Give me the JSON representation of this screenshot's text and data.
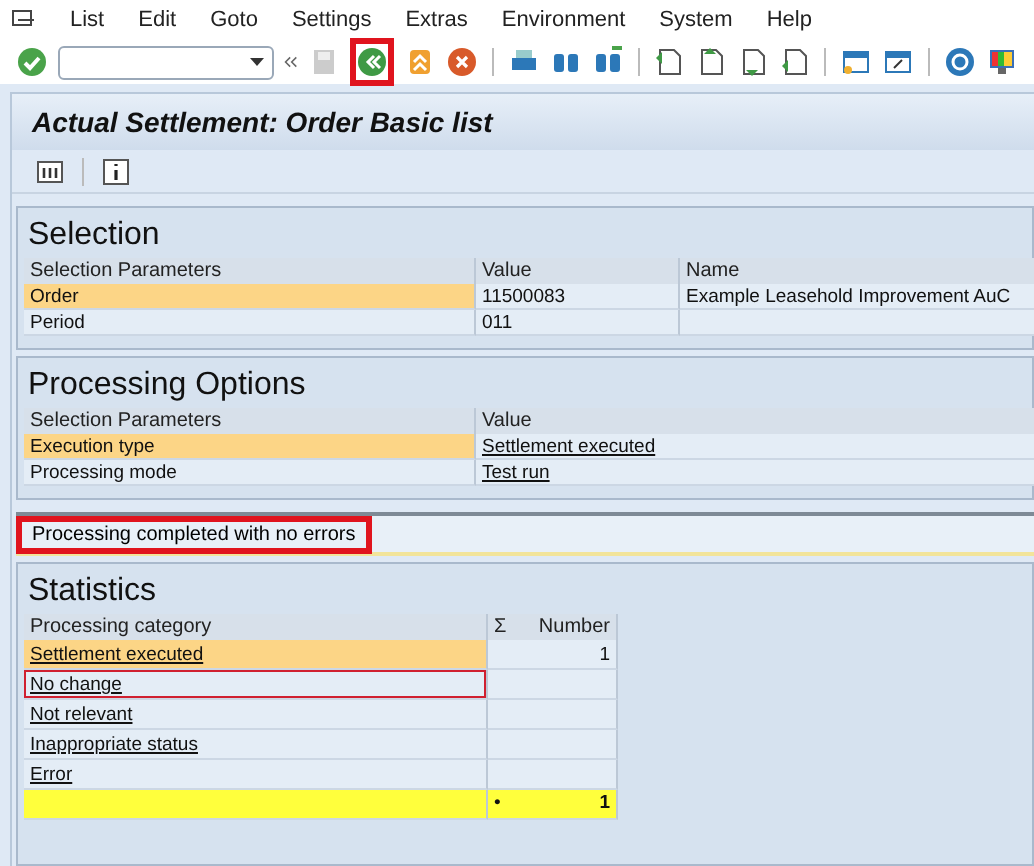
{
  "menu": [
    "List",
    "Edit",
    "Goto",
    "Settings",
    "Extras",
    "Environment",
    "System",
    "Help"
  ],
  "toolbar": {
    "back_framed": true
  },
  "title": "Actual Settlement: Order Basic list",
  "selection": {
    "heading": "Selection",
    "columns": [
      "Selection Parameters",
      "Value",
      "Name"
    ],
    "rows": [
      {
        "cells": [
          "Order",
          "11500083",
          "Example Leasehold Improvement AuC"
        ],
        "highlighted": true
      },
      {
        "cells": [
          "Period",
          "011",
          ""
        ],
        "highlighted": false
      }
    ]
  },
  "processing_options": {
    "heading": "Processing Options",
    "columns": [
      "Selection Parameters",
      "Value"
    ],
    "rows": [
      {
        "cells": [
          "Execution type",
          "Settlement executed"
        ],
        "highlighted": true
      },
      {
        "cells": [
          "Processing mode",
          "Test run"
        ],
        "highlighted": false
      }
    ]
  },
  "message": {
    "text": "Processing completed with no errors",
    "framed": true
  },
  "statistics": {
    "heading": "Statistics",
    "columns": [
      "Processing category",
      "Σ",
      "Number"
    ],
    "rows": [
      {
        "category": "Settlement executed",
        "number": "1",
        "highlighted": true,
        "focused": false
      },
      {
        "category": "No change",
        "number": "",
        "highlighted": false,
        "focused": true
      },
      {
        "category": "Not relevant",
        "number": "",
        "highlighted": false,
        "focused": false
      },
      {
        "category": "Inappropriate status",
        "number": "",
        "highlighted": false,
        "focused": false
      },
      {
        "category": "Error",
        "number": "",
        "highlighted": false,
        "focused": false
      }
    ],
    "total": {
      "marker": "•",
      "number": "1"
    }
  }
}
